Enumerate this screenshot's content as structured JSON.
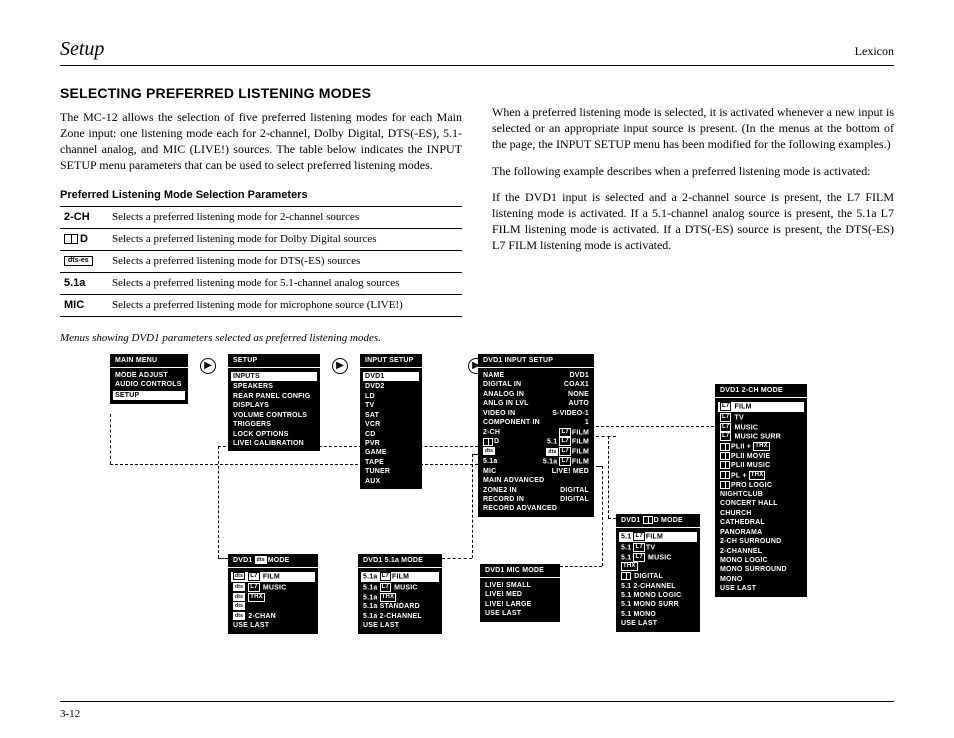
{
  "header": {
    "left": "Setup",
    "right": "Lexicon"
  },
  "title": "SELECTING PREFERRED LISTENING MODES",
  "left_para": "The MC-12 allows the selection of five preferred listening modes for each Main Zone input: one listening mode each for 2-channel, Dolby Digital, DTS(-ES), 5.1-channel analog, and MIC (LIVE!) sources. The table below indicates the INPUT SETUP menu parameters that can be used to select preferred listening modes.",
  "subhead": "Preferred Listening Mode Selection Parameters",
  "params": [
    {
      "k": "2-CH",
      "v": "Selects a preferred listening mode for 2-channel sources"
    },
    {
      "k": "DD",
      "v": "Selects a preferred listening mode for Dolby Digital sources"
    },
    {
      "k": "DTS",
      "v": "Selects a preferred listening mode for DTS(-ES) sources"
    },
    {
      "k": "5.1a",
      "v": "Selects a preferred listening mode for 5.1-channel analog sources"
    },
    {
      "k": "MIC",
      "v": "Selects a preferred listening mode for microphone source (LIVE!)"
    }
  ],
  "right_p1": "When a preferred listening mode is selected, it is activated whenever a new input is selected or an appropriate input source is present. (In the menus at the bottom of the page, the INPUT SETUP menu has been modified for the following examples.)",
  "right_p2": "The following example describes when a preferred listening mode is activated:",
  "right_p3": "If the DVD1 input is selected and a 2-channel source is present, the L7 FILM listening mode is activated. If a 5.1-channel analog source is present, the 5.1a L7 FILM listening mode is activated. If a DTS(-ES) source is present, the DTS(-ES) L7 FILM listening mode is activated.",
  "caption": "Menus showing DVD1 parameters selected as preferred listening modes.",
  "m_main": {
    "title": "MAIN MENU",
    "items": [
      "MODE ADJUST",
      "AUDIO CONTROLS"
    ],
    "sel": "SETUP"
  },
  "m_setup": {
    "title": "SETUP",
    "sel": "INPUTS",
    "items": [
      "SPEAKERS",
      "REAR PANEL CONFIG",
      "DISPLAYS",
      "VOLUME CONTROLS",
      "TRIGGERS",
      "LOCK OPTIONS",
      "LIVE! CALIBRATION"
    ]
  },
  "m_inputs": {
    "title": "INPUT SETUP",
    "sel": "DVD1",
    "items": [
      "DVD2",
      "LD",
      "TV",
      "SAT",
      "VCR",
      "CD",
      "PVR",
      "GAME",
      "TAPE",
      "TUNER",
      "AUX"
    ]
  },
  "m_dvd1": {
    "title": "DVD1 INPUT SETUP",
    "rows": [
      [
        "NAME",
        "DVD1"
      ],
      [
        "DIGITAL IN",
        "COAX1"
      ],
      [
        "ANALOG IN",
        "NONE"
      ],
      [
        "ANLG IN LVL",
        "AUTO"
      ],
      [
        "VIDEO IN",
        "S-VIDEO-1"
      ],
      [
        "COMPONENT IN",
        "1"
      ],
      [
        "2-CH",
        "L7 FILM"
      ],
      [
        "DD D",
        "5.1 L7 FILM"
      ],
      [
        "DTS",
        "DTS L7 FILM"
      ],
      [
        "5.1a",
        "5.1a L7 FILM"
      ],
      [
        "MIC",
        "LIVE! MED"
      ],
      [
        "MAIN ADVANCED",
        ""
      ],
      [
        "ZONE2 IN",
        "DIGITAL"
      ],
      [
        "RECORD IN",
        "DIGITAL"
      ],
      [
        "RECORD ADVANCED",
        ""
      ]
    ]
  },
  "m_2ch": {
    "title": "DVD1 2-CH MODE",
    "sel": "L7 FILM",
    "items": [
      "L7 TV",
      "L7 MUSIC",
      "L7 MUSIC SURR",
      "DD PLII + THX",
      "DD PLII MOVIE",
      "DD PLII MUSIC",
      "DD PL + THX",
      "DD PRO LOGIC",
      "NIGHTCLUB",
      "CONCERT HALL",
      "CHURCH",
      "CATHEDRAL",
      "PANORAMA",
      "2-CH SURROUND",
      "2-CHANNEL",
      "MONO LOGIC",
      "MONO SURROUND",
      "MONO",
      "USE LAST"
    ]
  },
  "m_dd": {
    "title": "DVD1 DD D MODE",
    "sel": "5.1 L7 FILM",
    "items": [
      "5.1 L7 TV",
      "5.1 L7 MUSIC",
      "THX",
      "DD DIGITAL",
      "5.1 2-CHANNEL",
      "5.1 MONO LOGIC",
      "5.1 MONO SURR",
      "5.1 MONO",
      "USE LAST"
    ]
  },
  "m_dts": {
    "title": "DVD1 DTS MODE",
    "sel": "DTS L7 FILM",
    "items": [
      "DTS L7 MUSIC",
      "DTS THX",
      "DTS",
      "DTS 2-CHAN",
      "USE LAST"
    ]
  },
  "m_51a": {
    "title": "DVD1 5.1a MODE",
    "sel": "5.1a L7 FILM",
    "items": [
      "5.1a L7 MUSIC",
      "5.1a THX",
      "5.1a STANDARD",
      "5.1a 2-CHANNEL",
      "USE LAST"
    ]
  },
  "m_mic": {
    "title": "DVD1 MIC  MODE",
    "items": [
      "LIVE! SMALL",
      "LIVE! MED",
      "LIVE! LARGE",
      "USE LAST"
    ]
  },
  "pagenum": "3-12"
}
